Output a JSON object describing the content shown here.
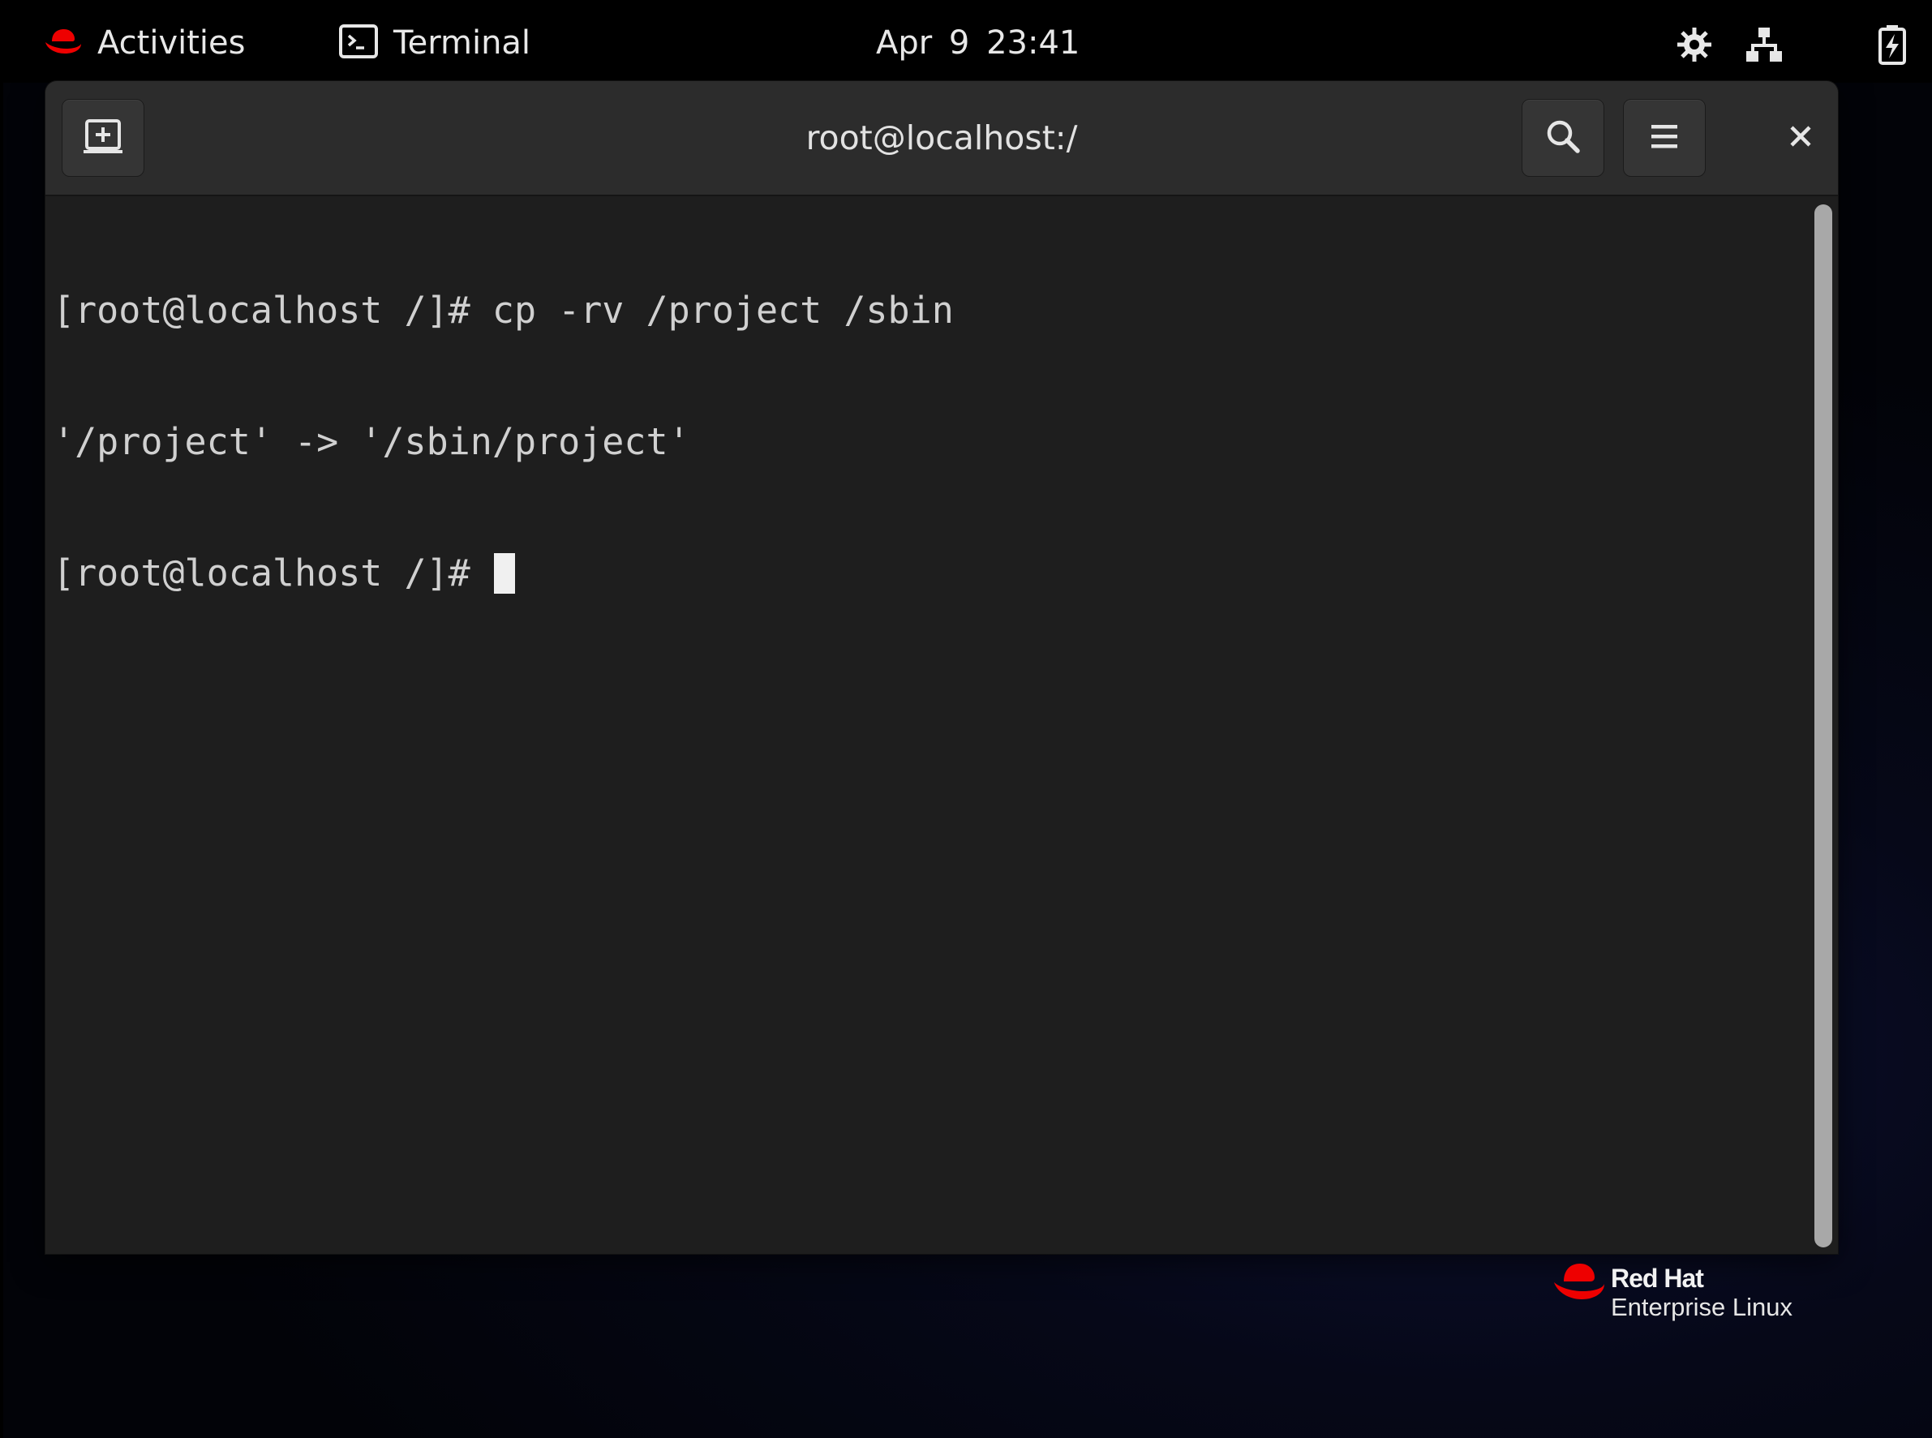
{
  "topbar": {
    "activities_label": "Activities",
    "app_name": "Terminal",
    "clock": "Apr 9  23:41",
    "tray_icons": [
      "accessibility-icon",
      "network-wired-icon",
      "battery-charging-icon"
    ],
    "brand_color": "#ee0000"
  },
  "window": {
    "title": "root@localhost:/",
    "buttons": [
      "new-tab-icon",
      "search-icon",
      "hamburger-menu-icon",
      "close-icon"
    ]
  },
  "terminal": {
    "lines": [
      "[root@localhost /]# cp -rv /project /sbin",
      "'/project' -> '/sbin/project'"
    ],
    "prompt": "[root@localhost /]# ",
    "cursor_visible": true
  },
  "branding": {
    "line1": "Red Hat",
    "line2": "Enterprise Linux"
  }
}
